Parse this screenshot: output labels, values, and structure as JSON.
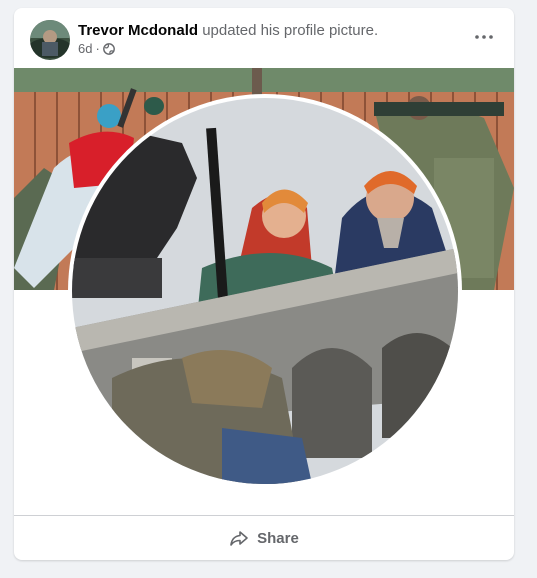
{
  "post": {
    "author": "Trevor Mcdonald",
    "action": "updated his profile picture.",
    "time": "6d",
    "separator": "·",
    "audience_icon": "globe-icon",
    "more_icon": "more-dots-icon"
  },
  "actions": {
    "share_label": "Share",
    "share_icon": "share-arrow-icon"
  },
  "colors": {
    "page_bg": "#f0f2f5",
    "card_bg": "#ffffff",
    "name_text": "#050505",
    "secondary_text": "#65676b",
    "divider": "#ced0d4"
  }
}
